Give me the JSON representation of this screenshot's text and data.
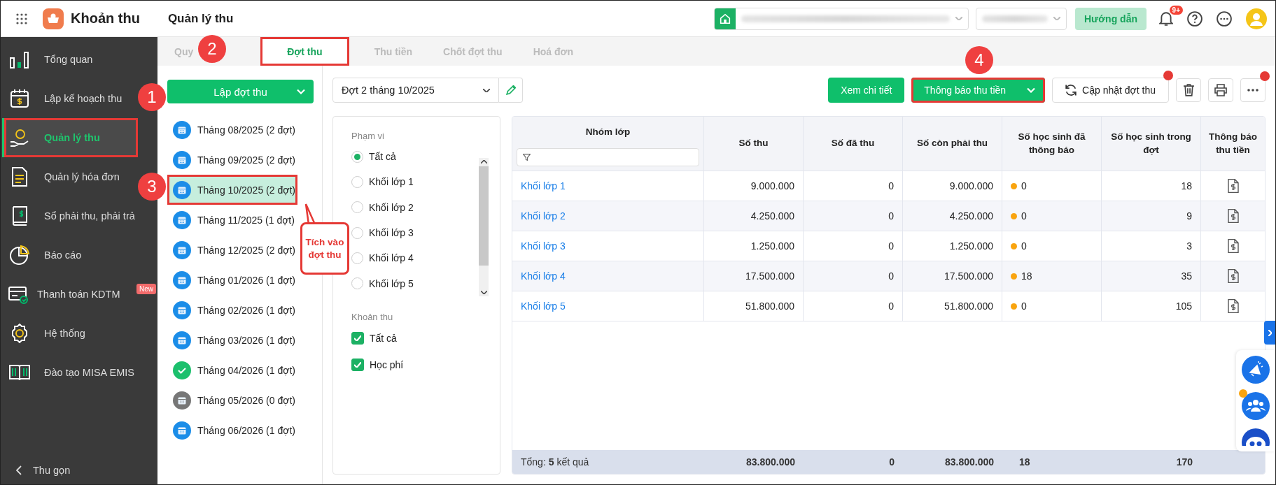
{
  "app": {
    "title": "Khoản thu",
    "page_title": "Quản lý thu",
    "help_button": "Hướng dẫn",
    "notification_badge": "9+"
  },
  "sidebar": {
    "items": [
      {
        "label": "Tổng quan",
        "selected": false,
        "highlighted": false
      },
      {
        "label": "Lập kế hoạch thu",
        "selected": false,
        "highlighted": false
      },
      {
        "label": "Quản lý thu",
        "selected": true,
        "highlighted": true
      },
      {
        "label": "Quản lý hóa đơn",
        "selected": false,
        "highlighted": false
      },
      {
        "label": "Sổ phải thu, phải trả",
        "selected": false,
        "highlighted": false
      },
      {
        "label": "Báo cáo",
        "selected": false,
        "highlighted": false
      },
      {
        "label": "Thanh toán KDTM",
        "selected": false,
        "highlighted": false,
        "badge": "New"
      },
      {
        "label": "Hệ thống",
        "selected": false,
        "highlighted": false
      },
      {
        "label": "Đào tạo MISA EMIS",
        "selected": false,
        "highlighted": false
      }
    ],
    "collapse": "Thu gọn"
  },
  "tabs": [
    {
      "label": "Quy",
      "selected": false,
      "highlighted": false
    },
    {
      "label": "Đợt thu",
      "selected": true,
      "highlighted": true
    },
    {
      "label": "Thu tiền",
      "selected": false,
      "highlighted": false
    },
    {
      "label": "Chốt đợt thu",
      "selected": false,
      "highlighted": false
    },
    {
      "label": "Hoá đơn",
      "selected": false,
      "highlighted": false
    }
  ],
  "periods": {
    "create_button": "Lập đợt thu",
    "items": [
      {
        "label": "Tháng 08/2025 (2 đợt)",
        "kind": "open",
        "selected": false,
        "highlighted": false
      },
      {
        "label": "Tháng 09/2025 (2 đợt)",
        "kind": "open",
        "selected": false,
        "highlighted": false
      },
      {
        "label": "Tháng 10/2025 (2 đợt)",
        "kind": "open",
        "selected": true,
        "highlighted": true
      },
      {
        "label": "Tháng 11/2025 (1 đợt)",
        "kind": "open",
        "selected": false,
        "highlighted": false
      },
      {
        "label": "Tháng 12/2025 (2 đợt)",
        "kind": "open",
        "selected": false,
        "highlighted": false
      },
      {
        "label": "Tháng 01/2026 (1 đợt)",
        "kind": "open",
        "selected": false,
        "highlighted": false
      },
      {
        "label": "Tháng 02/2026 (1 đợt)",
        "kind": "open",
        "selected": false,
        "highlighted": false
      },
      {
        "label": "Tháng 03/2026 (1 đợt)",
        "kind": "open",
        "selected": false,
        "highlighted": false
      },
      {
        "label": "Tháng 04/2026 (1 đợt)",
        "kind": "done",
        "selected": false,
        "highlighted": false
      },
      {
        "label": "Tháng 05/2026 (0 đợt)",
        "kind": "empty",
        "selected": false,
        "highlighted": false
      },
      {
        "label": "Tháng 06/2026 (1 đợt)",
        "kind": "open",
        "selected": false,
        "highlighted": false
      }
    ]
  },
  "batch_select": {
    "value": "Đợt 2 tháng 10/2025"
  },
  "filters": {
    "scope": {
      "title": "Phạm vi",
      "options": [
        {
          "label": "Tất cả",
          "selected": true
        },
        {
          "label": "Khối lớp 1",
          "selected": false
        },
        {
          "label": "Khối lớp 2",
          "selected": false
        },
        {
          "label": "Khối lớp 3",
          "selected": false
        },
        {
          "label": "Khối lớp 4",
          "selected": false
        },
        {
          "label": "Khối lớp 5",
          "selected": false
        }
      ]
    },
    "fees": {
      "title": "Khoản thu",
      "options": [
        {
          "label": "Tất cả",
          "checked": true
        },
        {
          "label": "Học phí",
          "checked": true
        }
      ]
    }
  },
  "toolbar": {
    "buttons": [
      {
        "label": "Xem chi tiết",
        "kind": "primary",
        "highlighted": false
      },
      {
        "label": "Thông báo thu tiền",
        "kind": "split",
        "highlighted": true
      },
      {
        "label": "Cập nhật đợt thu",
        "kind": "refresh",
        "highlighted": false,
        "alert": true
      }
    ],
    "icon_buttons": [
      {
        "alert": false
      },
      {
        "alert": false
      },
      {
        "alert": true
      }
    ]
  },
  "table": {
    "columns": [
      "Nhóm lớp",
      "Số thu",
      "Số đã thu",
      "Số còn phải thu",
      "Số học sinh đã thông báo",
      "Số học sinh trong đợt",
      "Thông báo thu tiền"
    ],
    "rows": [
      {
        "group": "Khối lớp 1",
        "amount": "9.000.000",
        "paid": "0",
        "remaining": "9.000.000",
        "notified": "0",
        "students": "18"
      },
      {
        "group": "Khối lớp 2",
        "amount": "4.250.000",
        "paid": "0",
        "remaining": "4.250.000",
        "notified": "0",
        "students": "9"
      },
      {
        "group": "Khối lớp 3",
        "amount": "1.250.000",
        "paid": "0",
        "remaining": "1.250.000",
        "notified": "0",
        "students": "3"
      },
      {
        "group": "Khối lớp 4",
        "amount": "17.500.000",
        "paid": "0",
        "remaining": "17.500.000",
        "notified": "18",
        "students": "35"
      },
      {
        "group": "Khối lớp 5",
        "amount": "51.800.000",
        "paid": "0",
        "remaining": "51.800.000",
        "notified": "0",
        "students": "105"
      }
    ],
    "footer": {
      "label": "Tổng: **5** kết quả",
      "amount": "83.800.000",
      "paid": "0",
      "remaining": "83.800.000",
      "notified": "18",
      "students": "170"
    }
  },
  "annotations": {
    "markers": [
      "1",
      "2",
      "3",
      "4"
    ],
    "callout": "Tích vào đợt thu"
  }
}
